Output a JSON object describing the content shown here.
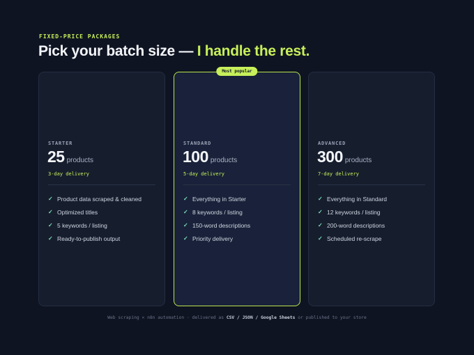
{
  "header": {
    "eyebrow": "FIXED-PRICE PACKAGES",
    "headline_main": "Pick your batch size — ",
    "headline_accent": "I handle the rest."
  },
  "colors": {
    "background": "#0f1422",
    "accent": "#c7f05a",
    "check": "#7ee0b8"
  },
  "packages": [
    {
      "tier": "STARTER",
      "quantity": "25",
      "unit": "products",
      "delivery": "3-day delivery",
      "features": [
        "Product data scraped & cleaned",
        "Optimized titles",
        "5 keywords / listing",
        "Ready-to-publish output"
      ]
    },
    {
      "badge": "Most popular",
      "tier": "STANDARD",
      "quantity": "100",
      "unit": "products",
      "delivery": "5-day delivery",
      "features": [
        "Everything in Starter",
        "8 keywords / listing",
        "150-word descriptions",
        "Priority delivery"
      ]
    },
    {
      "tier": "ADVANCED",
      "quantity": "300",
      "unit": "products",
      "delivery": "7-day delivery",
      "features": [
        "Everything in Standard",
        "12 keywords / listing",
        "200-word descriptions",
        "Scheduled re-scrape"
      ]
    }
  ],
  "check_glyph": "✓",
  "footer": {
    "prefix": "Web scraping × n8n automation  ·  delivered as ",
    "formats": "CSV / JSON / Google Sheets",
    "suffix": " or published to your store"
  }
}
